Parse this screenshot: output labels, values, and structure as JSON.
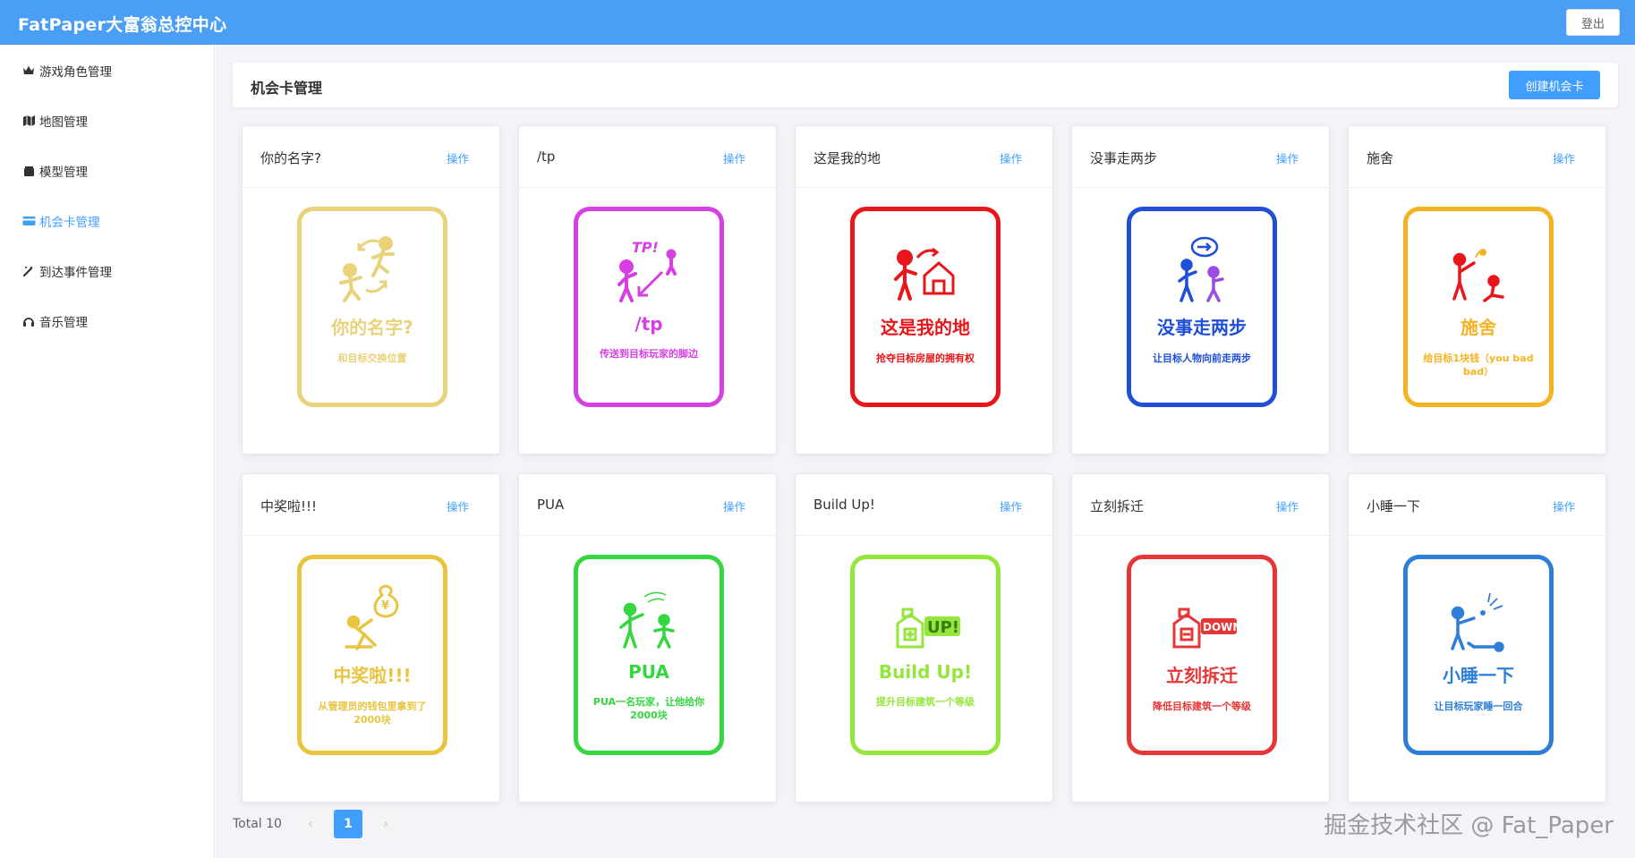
{
  "app": {
    "title": "FatPaper大富翁总控中心",
    "logout_label": "登出"
  },
  "sidebar": {
    "items": [
      {
        "label": "游戏角色管理",
        "icon": "crown-icon"
      },
      {
        "label": "地图管理",
        "icon": "map-icon"
      },
      {
        "label": "模型管理",
        "icon": "box-icon"
      },
      {
        "label": "机会卡管理",
        "icon": "card-icon",
        "active": true
      },
      {
        "label": "到达事件管理",
        "icon": "magic-wand-icon"
      },
      {
        "label": "音乐管理",
        "icon": "headphones-icon"
      }
    ]
  },
  "header": {
    "title": "机会卡管理",
    "create_label": "创建机会卡"
  },
  "cards": [
    {
      "title": "你的名字?",
      "op": "操作",
      "name": "你的名字?",
      "desc": "和目标交换位置",
      "color": "#e8d27a"
    },
    {
      "title": "/tp",
      "op": "操作",
      "name": "/tp",
      "desc": "传送到目标玩家的脚边",
      "color": "#d63fe3"
    },
    {
      "title": "这是我的地",
      "op": "操作",
      "name": "这是我的地",
      "desc": "抢夺目标房屋的拥有权",
      "color": "#e8161a"
    },
    {
      "title": "没事走两步",
      "op": "操作",
      "name": "没事走两步",
      "desc": "让目标人物向前走两步",
      "color": "#1f4fd6"
    },
    {
      "title": "施舍",
      "op": "操作",
      "name": "施舍",
      "desc": "给目标1块钱（you bad bad）",
      "color": "#f5b323"
    },
    {
      "title": "中奖啦!!!",
      "op": "操作",
      "name": "中奖啦!!!",
      "desc": "从管理员的钱包里拿到了2000块",
      "color": "#e9c440"
    },
    {
      "title": "PUA",
      "op": "操作",
      "name": "PUA",
      "desc": "PUA一名玩家，让他给你2000块",
      "color": "#35d63f"
    },
    {
      "title": "Build Up!",
      "op": "操作",
      "name": "Build Up!",
      "desc": "提升目标建筑一个等级",
      "color": "#95e63c"
    },
    {
      "title": "立刻拆迁",
      "op": "操作",
      "name": "立刻拆迁",
      "desc": "降低目标建筑一个等级",
      "color": "#e53737"
    },
    {
      "title": "小睡一下",
      "op": "操作",
      "name": "小睡一下",
      "desc": "让目标玩家睡一回合",
      "color": "#2f7fd8"
    }
  ],
  "pagination": {
    "total_label": "Total 10",
    "current": "1",
    "prev": "‹",
    "next": "›"
  },
  "watermark": "掘金技术社区 @ Fat_Paper"
}
